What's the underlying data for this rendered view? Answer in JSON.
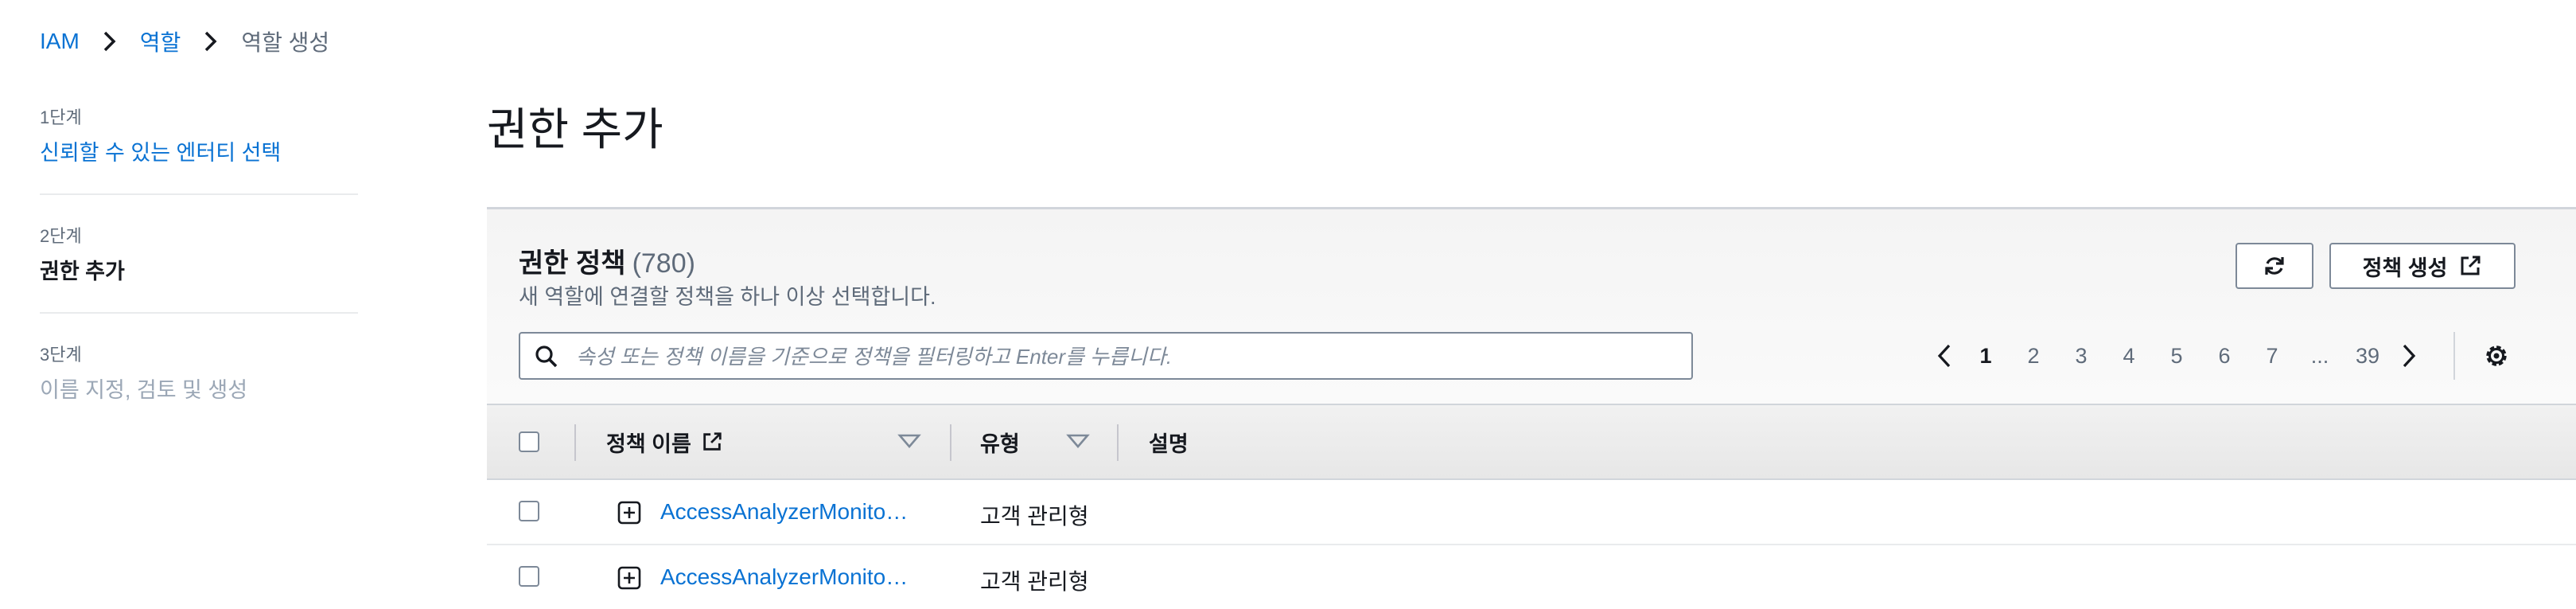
{
  "breadcrumb": {
    "items": [
      "IAM",
      "역할",
      "역할 생성"
    ]
  },
  "steps": [
    {
      "number": "1단계",
      "title": "신뢰할 수 있는 엔터티 선택"
    },
    {
      "number": "2단계",
      "title": "권한 추가"
    },
    {
      "number": "3단계",
      "title": "이름 지정, 검토 및 생성"
    }
  ],
  "page_title": "권한 추가",
  "panel": {
    "title": "권한 정책",
    "count": "(780)",
    "description": "새 역할에 연결할 정책을 하나 이상 선택합니다.",
    "create_button": "정책 생성",
    "search_placeholder": "속성 또는 정책 이름을 기준으로 정책을 필터링하고 Enter를 누릅니다."
  },
  "pagination": {
    "pages": [
      "1",
      "2",
      "3",
      "4",
      "5",
      "6",
      "7",
      "...",
      "39"
    ],
    "current": "1"
  },
  "table": {
    "columns": [
      "정책 이름",
      "유형",
      "설명"
    ],
    "rows": [
      {
        "name": "AccessAnalyzerMonito…",
        "type": "고객 관리형",
        "description": ""
      },
      {
        "name": "AccessAnalyzerMonito…",
        "type": "고객 관리형",
        "description": ""
      }
    ]
  },
  "colors": {
    "link": "#0972d3",
    "text": "#16191f",
    "muted": "#5f6b7a",
    "border": "#7d8998"
  }
}
